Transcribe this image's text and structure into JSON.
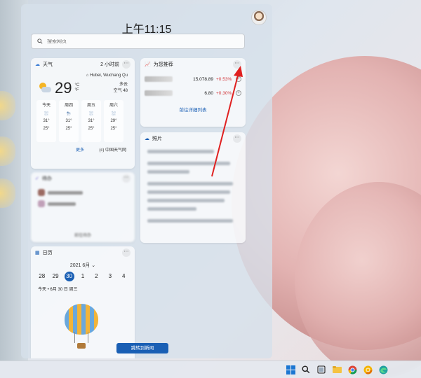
{
  "clock": {
    "time": "上午11:15"
  },
  "search": {
    "placeholder": "搜索网页"
  },
  "weather": {
    "title": "天气",
    "updated": "2 小时前",
    "location": "Hubei, Wuchang Qu",
    "temp": "29",
    "unit_c": "°C",
    "unit_f": "°F",
    "condition": "多云",
    "aqi": "空气 48",
    "forecast": [
      {
        "day": "今天",
        "hi": "31°",
        "lo": "25°"
      },
      {
        "day": "周四",
        "hi": "31°",
        "lo": "25°"
      },
      {
        "day": "周五",
        "hi": "31°",
        "lo": "25°"
      },
      {
        "day": "周六",
        "hi": "29°",
        "lo": "25°"
      }
    ],
    "more": "更多",
    "source": "(c) 中国天气网"
  },
  "todo": {
    "title": "待办",
    "footer": "前往待办"
  },
  "calendar": {
    "title": "日历",
    "month": "2021 6月",
    "days": [
      "28",
      "29",
      "30",
      "1",
      "2",
      "3",
      "4"
    ],
    "today": "今天 • 6月 30 日 周三",
    "button": "跳转到新闻"
  },
  "recommendations": {
    "title": "为您推荐",
    "stocks": [
      {
        "value": "15,078.89",
        "change": "+0.53%"
      },
      {
        "value": "6.80",
        "change": "+0.30%"
      }
    ],
    "footer": "前往详细列表"
  },
  "photos": {
    "title": "照片"
  },
  "colors": {
    "accent": "#1a5fb4",
    "positive": "#d13438",
    "arrow": "#e02020"
  },
  "taskbar": {
    "icons": [
      "windows-icon",
      "search-icon",
      "task-view-icon",
      "file-explorer-icon",
      "chrome-icon",
      "chrome-canary-icon",
      "edge-icon"
    ]
  }
}
